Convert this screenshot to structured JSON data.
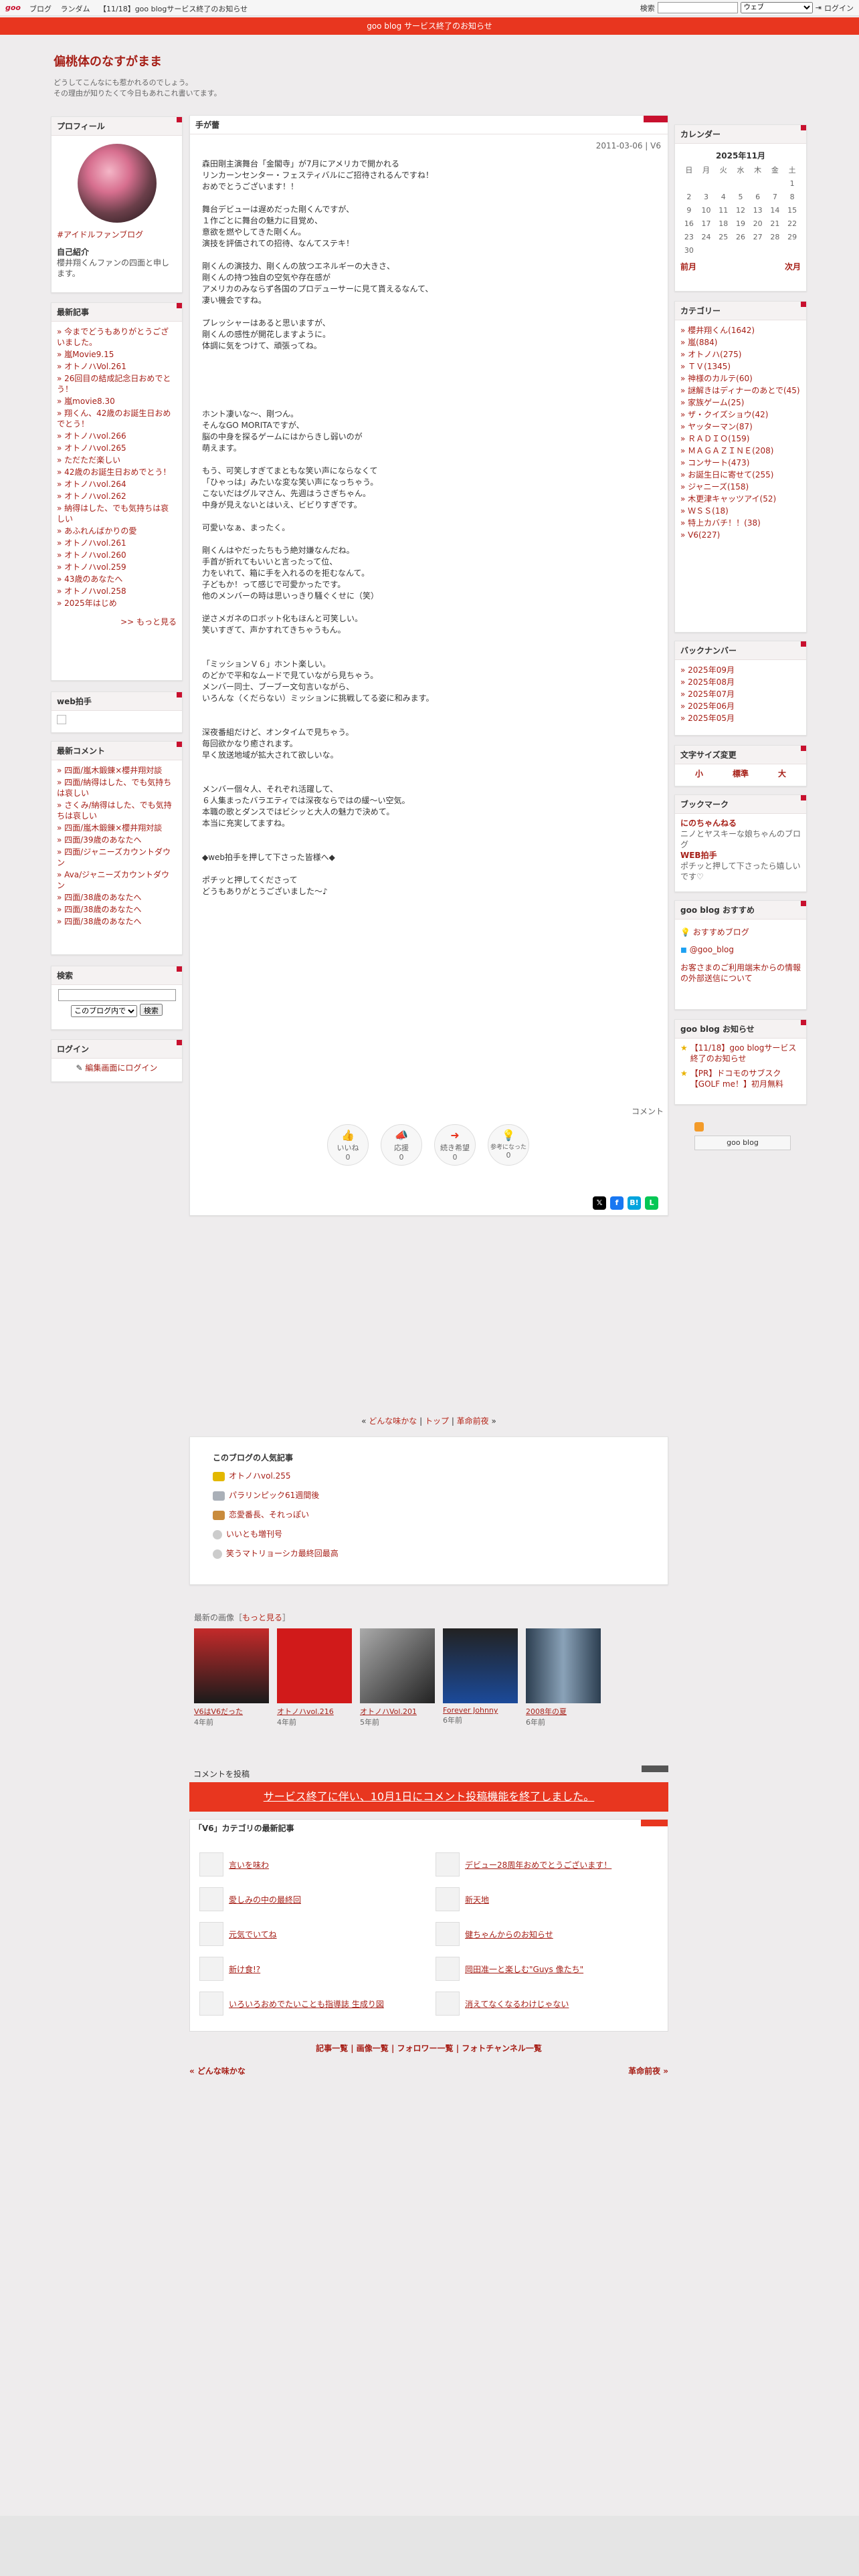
{
  "topbar": {
    "logo": "goo",
    "nav": [
      "ブログ",
      "ランダム",
      "【11/18】goo blogサービス終了のお知らせ"
    ],
    "search_label": "検索",
    "search_select": "ウェブ",
    "login": "ログイン"
  },
  "notice": "goo blog サービス終了のお知らせ",
  "blog": {
    "title": "偏桃体のなすがまま",
    "desc1": "どうしてこんなにも惹かれるのでしょう。",
    "desc2": "その理由が知りたくて今日もあれこれ書いてます。"
  },
  "profile": {
    "title": "プロフィール",
    "tag": "#アイドルファンブログ",
    "intro_label": "自己紹介",
    "intro": "櫻井翔くんファンの四面と申します。"
  },
  "recent": {
    "title": "最新記事",
    "items": [
      "今までどうもありがとうございました。",
      "嵐Movie9.15",
      "オトノハVol.261",
      "26回目の結成記念日おめでとう！",
      "嵐movie8.30",
      "翔くん、42歳のお誕生日おめでとう！",
      "オトノハvol.266",
      "オトノハvol.265",
      "ただただ楽しい",
      "42歳のお誕生日おめでとう！",
      "オトノハvol.264",
      "オトノハvol.262",
      "納得はした、でも気持ちは哀しい",
      "あふれんばかりの愛",
      "オトノハvol.261",
      "オトノハvol.260",
      "オトノハvol.259",
      "43歳のあなたへ",
      "オトノハvol.258",
      "2025年はじめ"
    ],
    "more": ">> もっと見る"
  },
  "webclap": {
    "title": "web拍手"
  },
  "comments": {
    "title": "最新コメント",
    "items": [
      "四面/嵐木鍛錬×櫻井翔対談",
      "四面/納得はした、でも気持ちは哀しい",
      "さくみ/納得はした、でも気持ちは哀しい",
      "四面/嵐木鍛錬×櫻井翔対談",
      "四面/39歳のあなたへ",
      "四面/ジャニーズカウントダウン",
      "Ava/ジャニーズカウントダウン",
      "四面/38歳のあなたへ",
      "四面/38歳のあなたへ",
      "四面/38歳のあなたへ"
    ]
  },
  "search": {
    "title": "検索",
    "scope": "このブログ内で",
    "button": "検索"
  },
  "login": {
    "title": "ログイン",
    "link": "編集画面にログイン"
  },
  "post": {
    "category": "手が蕾",
    "date": "2011-03-06 | V6",
    "comment_link": "コメント",
    "body": "森田剛主演舞台「金閣寺」が7月にアメリカで開かれる\nリンカーンセンター・フェスティバルにご招待されるんですね！\nおめでとうございます！！\n\n舞台デビューは遅めだった剛くんですが、\n１作ごとに舞台の魅力に目覚め、\n意欲を燃やしてきた剛くん。\n演技を評価されての招待、なんてステキ！\n\n剛くんの演技力、剛くんの放つエネルギーの大きさ、\n剛くんの持つ独自の空気や存在感が\nアメリカのみならず各国のプロデューサーに見て貰えるなんて、\n凄い機会ですね。\n\nプレッシャーはあると思いますが、\n剛くんの感性が開花しますように。\n体調に気をつけて、頑張ってね。\n\n\n\n\n\nホント凄いな～、剛つん。\nそんなGO MORITAですが、\n脳の中身を探るゲームにはからきし弱いのが\n萌えます。\n\nもう、可笑しすぎてまともな笑い声にならなくて\n「ひゃっは」みたいな変な笑い声になっちゃう。\nこないだはグルマさん、先週はうさぎちゃん。\n中身が見えないとはいえ、ビビりすぎです。\n\n可愛いなぁ、まったく。\n\n剛くんはやだったちもう絶対嫌なんだね。\n手首が折れてもいいと言ったって位、\n力をいれて、箱に手を入れるのを拒むなんて。\n子どもか！って感じで可愛かったです。\n他のメンバーの時は思いっきり騒ぐくせに（笑）\n\n逆さメガネのロボット化もほんと可笑しい。\n笑いすぎて、声かすれてきちゃうもん。\n\n\n「ミッションＶ６」ホント楽しい。\nのどかで平和なムードで見ていながら見ちゃう。\nメンバー同士、ブーブー文句言いながら、\nいろんな（くだらない）ミッションに挑戦してる姿に和みます。\n\n\n深夜番組だけど、オンタイムで見ちゃう。\n毎回欲かなり癒されます。\n早く放送地域が拡大されて欲しいな。\n\n\nメンバー個々人、それぞれ活躍して、\n６人集まったバラエティでは深夜ならではの緩～い空気。\n本職の歌とダンスではビシッと大人の魅力で決めて。\n本当に充実してますね。\n\n\n◆web拍手を押して下さった皆様へ◆\n\nポチッと押してくださって\nどうもありがとうございました～♪",
    "reactions": [
      {
        "label": "いいね",
        "count": "0"
      },
      {
        "label": "応援",
        "count": "0"
      },
      {
        "label": "続き希望",
        "count": "0"
      },
      {
        "label": "参考になった",
        "count": "0"
      }
    ]
  },
  "calendar": {
    "title": "カレンダー",
    "month": "2025年11月",
    "days": [
      "日",
      "月",
      "火",
      "水",
      "木",
      "金",
      "土"
    ],
    "weeks": [
      [
        "",
        "",
        "",
        "",
        "",
        "",
        "1"
      ],
      [
        "2",
        "3",
        "4",
        "5",
        "6",
        "7",
        "8"
      ],
      [
        "9",
        "10",
        "11",
        "12",
        "13",
        "14",
        "15"
      ],
      [
        "16",
        "17",
        "18",
        "19",
        "20",
        "21",
        "22"
      ],
      [
        "23",
        "24",
        "25",
        "26",
        "27",
        "28",
        "29"
      ],
      [
        "30",
        "",
        "",
        "",
        "",
        "",
        ""
      ]
    ],
    "prev": "前月",
    "next": "次月"
  },
  "categories": {
    "title": "カテゴリー",
    "items": [
      "櫻井翔くん(1642)",
      "嵐(884)",
      "オトノハ(275)",
      "ＴＶ(1345)",
      "神様のカルテ(60)",
      "謎解きはディナーのあとで(45)",
      "家族ゲーム(25)",
      "ザ・クイズショウ(42)",
      "ヤッターマン(87)",
      "ＲＡＤＩＯ(159)",
      "ＭＡＧＡＺＩＮＥ(208)",
      "コンサート(473)",
      "お誕生日に寄せて(255)",
      "ジャニーズ(158)",
      "木更津キャッツアイ(52)",
      "ＷＳＳ(18)",
      "特上カバチ！！(38)",
      "V6(227)"
    ]
  },
  "backnumber": {
    "title": "バックナンバー",
    "items": [
      "2025年09月",
      "2025年08月",
      "2025年07月",
      "2025年06月",
      "2025年05月"
    ]
  },
  "fontsize": {
    "title": "文字サイズ変更",
    "small": "小",
    "mid": "標準",
    "large": "大"
  },
  "bookmark": {
    "title": "ブックマーク",
    "name1": "にのちゃんねる",
    "desc1": "ニノとヤスキーな娘ちゃんのブログ",
    "name2": "WEB拍手",
    "desc2": "ポチッと押して下さったら嬉しいです♡"
  },
  "recommend": {
    "title": "goo blog おすすめ",
    "item1": "おすすめブログ",
    "item2": "@goo_blog",
    "note": "お客さまのご利用端末からの情報の外部送信について"
  },
  "gooinfo": {
    "title": "goo blog お知らせ",
    "item1": "【11/18】goo blogサービス終了のお知らせ",
    "item2": "【PR】ドコモのサブスク【GOLF me！】初月無料",
    "banner": "goo blog"
  },
  "pager": {
    "prev": "どんな味かな",
    "top": "トップ",
    "next": "革命前夜"
  },
  "popular": {
    "title": "このブログの人気記事",
    "items": [
      "オトノハvol.255",
      "パラリンピック61週間後",
      "恋愛番長、それっぽい",
      "いいとも増刊号",
      "笑うマトリョーシカ最終回最高"
    ]
  },
  "images": {
    "header": "最新の画像",
    "more": "もっと見る",
    "items": [
      {
        "cap": "V6はV6だった",
        "ago": "4年前"
      },
      {
        "cap": "オトノハvol.216",
        "ago": "4年前"
      },
      {
        "cap": "オトノハVol.201",
        "ago": "5年前"
      },
      {
        "cap": "Forever Johnny",
        "ago": "6年前"
      },
      {
        "cap": "2008年の夏",
        "ago": "6年前"
      }
    ]
  },
  "cpost": {
    "title": "コメントを投稿",
    "notice": "サービス終了に伴い、10月1日にコメント投稿機能を終了しました。"
  },
  "catnews": {
    "title": "「V6」カテゴリの最新記事",
    "items": [
      "言いを味わ",
      "デビュー28周年おめでとうございます！",
      "愛しみの中の最終回",
      "新天地",
      "元気でいてね",
      "健ちゃんからのお知らせ",
      "新け食!?",
      "岡田准一と楽しむ\"Guys 像たち\"",
      "いろいろおめでたいことも指導誌 生成り図",
      "消えてなくなるわけじゃない"
    ]
  },
  "footer": {
    "links": "記事一覧 | 画像一覧 | フォロワー一覧 | フォトチャンネル一覧",
    "prev": "« どんな味かな",
    "next": "革命前夜 »"
  }
}
